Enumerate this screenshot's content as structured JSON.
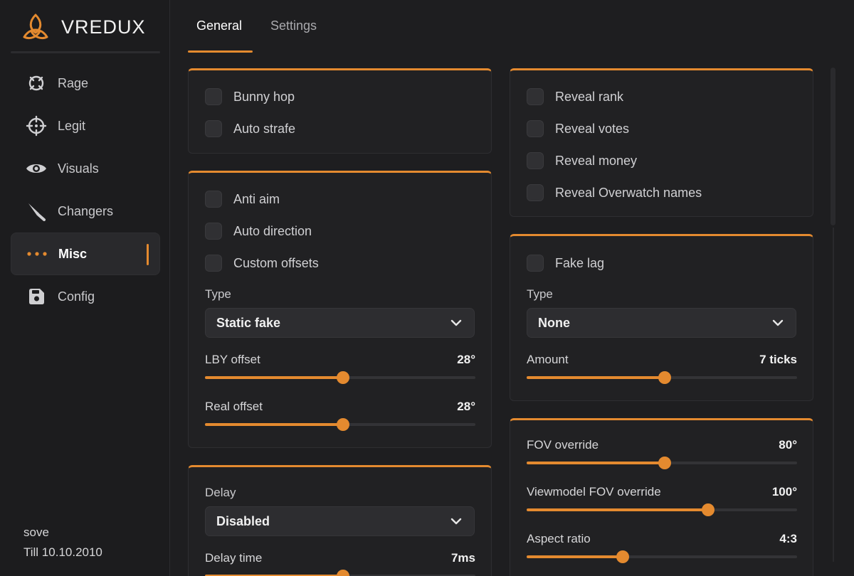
{
  "brand": {
    "name": "VREDUX",
    "accent": "#e48a2f"
  },
  "nav": [
    {
      "label": "Rage",
      "icon": "rage-icon"
    },
    {
      "label": "Legit",
      "icon": "crosshair-icon"
    },
    {
      "label": "Visuals",
      "icon": "eye-icon"
    },
    {
      "label": "Changers",
      "icon": "knife-icon"
    },
    {
      "label": "Misc",
      "icon": "dots-icon",
      "active": true
    },
    {
      "label": "Config",
      "icon": "floppy-icon"
    }
  ],
  "user": {
    "name": "sove",
    "expiry": "Till 10.10.2010"
  },
  "tabs": [
    {
      "label": "General",
      "active": true
    },
    {
      "label": "Settings",
      "active": false
    }
  ],
  "movement": {
    "bunny_hop": "Bunny hop",
    "auto_strafe": "Auto strafe"
  },
  "antiaim": {
    "anti_aim": "Anti aim",
    "auto_direction": "Auto direction",
    "custom_offsets": "Custom offsets",
    "type_label": "Type",
    "type_value": "Static fake",
    "lby_label": "LBY offset",
    "lby_value": "28°",
    "lby_fraction": 0.51,
    "real_label": "Real offset",
    "real_value": "28°",
    "real_fraction": 0.51
  },
  "delay": {
    "label": "Delay",
    "value": "Disabled",
    "time_label": "Delay time",
    "time_value": "7ms",
    "time_fraction": 0.51
  },
  "reveal": {
    "rank": "Reveal rank",
    "votes": "Reveal votes",
    "money": "Reveal money",
    "overwatch": "Reveal Overwatch names"
  },
  "fakelag": {
    "label": "Fake lag",
    "type_label": "Type",
    "type_value": "None",
    "amount_label": "Amount",
    "amount_value": "7 ticks",
    "amount_fraction": 0.51
  },
  "view": {
    "fov_label": "FOV override",
    "fov_value": "80°",
    "fov_fraction": 0.51,
    "vm_label": "Viewmodel FOV override",
    "vm_value": "100°",
    "vm_fraction": 0.67,
    "aspect_label": "Aspect ratio",
    "aspect_value": "4:3",
    "aspect_fraction": 0.356
  }
}
